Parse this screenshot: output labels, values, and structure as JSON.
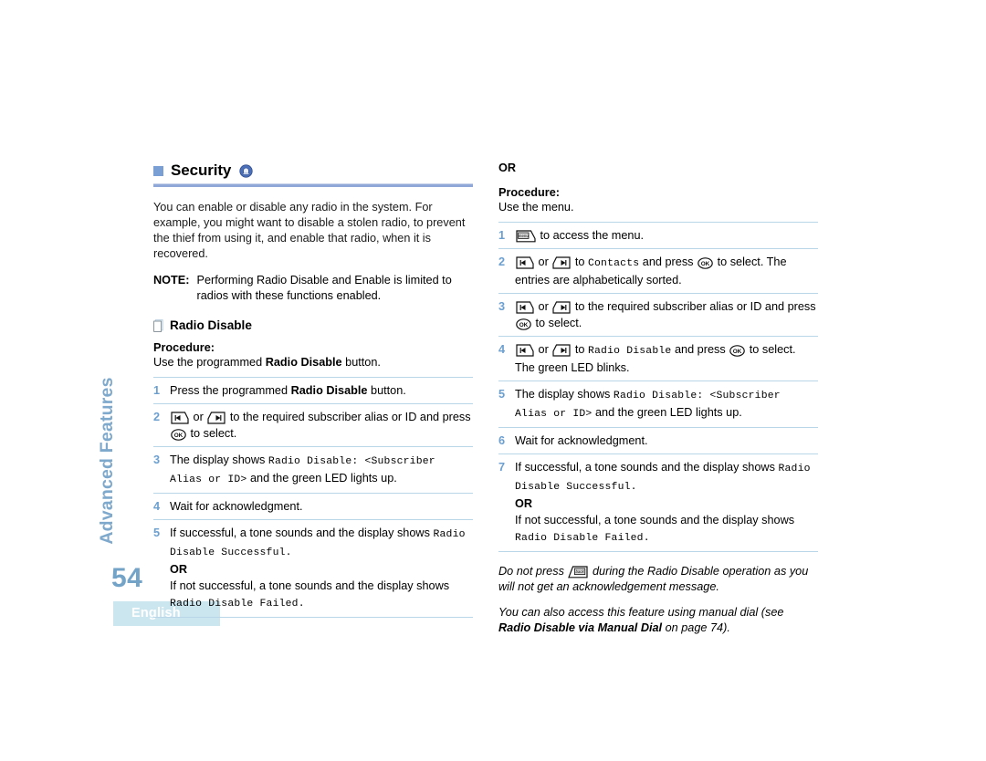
{
  "sidebar": {
    "section_label": "Advanced Features",
    "page_number": "54",
    "language_tab": "English"
  },
  "section": {
    "title": "Security",
    "icon": "security-padlock-icon",
    "bullet_color": "#7a9fd4",
    "rule_color": "#8fa8d8",
    "intro": "You can enable or disable any radio in the system. For example, you might want to disable a stolen radio, to prevent the thief from using it, and enable that radio, when it is recovered.",
    "note_label": "NOTE:",
    "note_text": "Performing Radio Disable and Enable is limited to radios with these functions enabled."
  },
  "left_column": {
    "sub_title": "Radio Disable",
    "sub_icon": "document-page-icon",
    "procedure_label": "Procedure:",
    "procedure_lead_prefix": "Use the programmed ",
    "procedure_lead_bold": "Radio Disable",
    "procedure_lead_suffix": " button.",
    "steps": [
      {
        "num": "1",
        "parts": [
          {
            "t": "text",
            "v": "Press the programmed "
          },
          {
            "t": "bold",
            "v": "Radio Disable"
          },
          {
            "t": "text",
            "v": " button."
          }
        ]
      },
      {
        "num": "2",
        "parts": [
          {
            "t": "icon",
            "v": "left-arrow-key-icon"
          },
          {
            "t": "text",
            "v": " or "
          },
          {
            "t": "icon",
            "v": "right-arrow-key-icon"
          },
          {
            "t": "text",
            "v": " to the required subscriber alias or ID and press "
          },
          {
            "t": "icon",
            "v": "ok-key-icon"
          },
          {
            "t": "text",
            "v": " to select."
          }
        ]
      },
      {
        "num": "3",
        "parts": [
          {
            "t": "text",
            "v": "The display shows "
          },
          {
            "t": "mono",
            "v": "Radio Disable: <Subscriber Alias or ID>"
          },
          {
            "t": "text",
            "v": " and the green LED lights up."
          }
        ]
      },
      {
        "num": "4",
        "parts": [
          {
            "t": "text",
            "v": "Wait for acknowledgment."
          }
        ]
      },
      {
        "num": "5",
        "parts": [
          {
            "t": "text",
            "v": "If successful, a tone sounds and the display shows "
          },
          {
            "t": "mono",
            "v": "Radio Disable Successful."
          },
          {
            "t": "br",
            "v": ""
          },
          {
            "t": "or",
            "v": "OR"
          },
          {
            "t": "br",
            "v": ""
          },
          {
            "t": "text",
            "v": "If not successful, a tone sounds and the display shows "
          },
          {
            "t": "mono",
            "v": "Radio Disable Failed."
          }
        ]
      }
    ]
  },
  "right_column": {
    "or_word": "OR",
    "procedure_label": "Procedure:",
    "procedure_lead": "Use the menu.",
    "steps": [
      {
        "num": "1",
        "parts": [
          {
            "t": "icon",
            "v": "menu-key-icon"
          },
          {
            "t": "text",
            "v": " to access the menu."
          }
        ]
      },
      {
        "num": "2",
        "parts": [
          {
            "t": "icon",
            "v": "left-arrow-key-icon"
          },
          {
            "t": "text",
            "v": " or "
          },
          {
            "t": "icon",
            "v": "right-arrow-key-icon"
          },
          {
            "t": "text",
            "v": " to "
          },
          {
            "t": "mono",
            "v": "Contacts"
          },
          {
            "t": "text",
            "v": " and press "
          },
          {
            "t": "icon",
            "v": "ok-key-icon"
          },
          {
            "t": "text",
            "v": " to select. The entries are alphabetically sorted."
          }
        ]
      },
      {
        "num": "3",
        "parts": [
          {
            "t": "icon",
            "v": "left-arrow-key-icon"
          },
          {
            "t": "text",
            "v": " or "
          },
          {
            "t": "icon",
            "v": "right-arrow-key-icon"
          },
          {
            "t": "text",
            "v": " to the required subscriber alias or ID and press "
          },
          {
            "t": "icon",
            "v": "ok-key-icon"
          },
          {
            "t": "text",
            "v": " to select."
          }
        ]
      },
      {
        "num": "4",
        "parts": [
          {
            "t": "icon",
            "v": "left-arrow-key-icon"
          },
          {
            "t": "text",
            "v": " or "
          },
          {
            "t": "icon",
            "v": "right-arrow-key-icon"
          },
          {
            "t": "text",
            "v": " to "
          },
          {
            "t": "mono",
            "v": "Radio Disable"
          },
          {
            "t": "text",
            "v": " and press "
          },
          {
            "t": "icon",
            "v": "ok-key-icon"
          },
          {
            "t": "text",
            "v": " to select. The green LED blinks."
          }
        ]
      },
      {
        "num": "5",
        "parts": [
          {
            "t": "text",
            "v": "The display shows "
          },
          {
            "t": "mono",
            "v": "Radio Disable: <Subscriber Alias or ID>"
          },
          {
            "t": "text",
            "v": " and the green LED lights up."
          }
        ]
      },
      {
        "num": "6",
        "parts": [
          {
            "t": "text",
            "v": "Wait for acknowledgment."
          }
        ]
      },
      {
        "num": "7",
        "parts": [
          {
            "t": "text",
            "v": "If successful, a tone sounds and the display shows "
          },
          {
            "t": "mono",
            "v": "Radio Disable Successful."
          },
          {
            "t": "br",
            "v": ""
          },
          {
            "t": "or",
            "v": "OR"
          },
          {
            "t": "br",
            "v": ""
          },
          {
            "t": "text",
            "v": "If not successful, a tone sounds and the display shows "
          },
          {
            "t": "mono",
            "v": "Radio Disable Failed."
          }
        ]
      }
    ],
    "italic_notes": [
      {
        "parts": [
          {
            "t": "text",
            "v": "Do not press "
          },
          {
            "t": "icon",
            "v": "back-key-icon"
          },
          {
            "t": "text",
            "v": " during the Radio Disable operation as you will not get an acknowledgement message."
          }
        ]
      },
      {
        "parts": [
          {
            "t": "text",
            "v": "You can also access this feature using manual dial (see "
          },
          {
            "t": "bold",
            "v": "Radio Disable via Manual Dial"
          },
          {
            "t": "text",
            "v": " on page 74)."
          }
        ]
      }
    ]
  }
}
